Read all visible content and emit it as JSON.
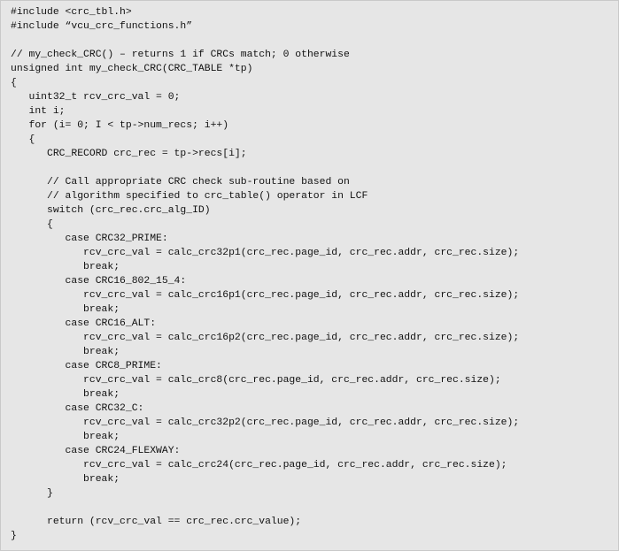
{
  "code": {
    "lines": [
      "#include <crc_tbl.h>",
      "#include “vcu_crc_functions.h”",
      "",
      "// my_check_CRC() – returns 1 if CRCs match; 0 otherwise",
      "unsigned int my_check_CRC(CRC_TABLE *tp)",
      "{",
      "   uint32_t rcv_crc_val = 0;",
      "   int i;",
      "   for (i= 0; I < tp->num_recs; i++)",
      "   {",
      "      CRC_RECORD crc_rec = tp->recs[i];",
      "",
      "      // Call appropriate CRC check sub-routine based on",
      "      // algorithm specified to crc_table() operator in LCF",
      "      switch (crc_rec.crc_alg_ID)",
      "      {",
      "         case CRC32_PRIME:",
      "            rcv_crc_val = calc_crc32p1(crc_rec.page_id, crc_rec.addr, crc_rec.size);",
      "            break;",
      "         case CRC16_802_15_4:",
      "            rcv_crc_val = calc_crc16p1(crc_rec.page_id, crc_rec.addr, crc_rec.size);",
      "            break;",
      "         case CRC16_ALT:",
      "            rcv_crc_val = calc_crc16p2(crc_rec.page_id, crc_rec.addr, crc_rec.size);",
      "            break;",
      "         case CRC8_PRIME:",
      "            rcv_crc_val = calc_crc8(crc_rec.page_id, crc_rec.addr, crc_rec.size);",
      "            break;",
      "         case CRC32_C:",
      "            rcv_crc_val = calc_crc32p2(crc_rec.page_id, crc_rec.addr, crc_rec.size);",
      "            break;",
      "         case CRC24_FLEXWAY:",
      "            rcv_crc_val = calc_crc24(crc_rec.page_id, crc_rec.addr, crc_rec.size);",
      "            break;",
      "      }",
      "",
      "      return (rcv_crc_val == crc_rec.crc_value);",
      "}"
    ]
  }
}
